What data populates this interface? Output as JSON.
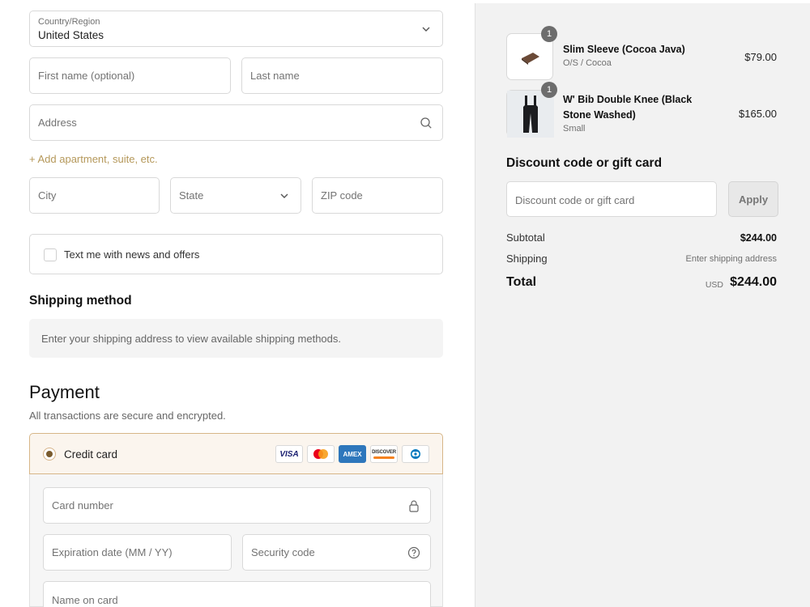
{
  "form": {
    "country": {
      "label": "Country/Region",
      "value": "United States"
    },
    "first_name": {
      "placeholder": "First name (optional)"
    },
    "last_name": {
      "placeholder": "Last name"
    },
    "address": {
      "placeholder": "Address"
    },
    "add_apartment": "+ Add apartment, suite, etc.",
    "city": {
      "placeholder": "City"
    },
    "state": {
      "placeholder": "State"
    },
    "zip": {
      "placeholder": "ZIP code"
    },
    "text_me": "Text me with news and offers"
  },
  "shipping": {
    "heading": "Shipping method",
    "message": "Enter your shipping address to view available shipping methods."
  },
  "payment": {
    "heading": "Payment",
    "subtitle": "All transactions are secure and encrypted.",
    "method_label": "Credit card",
    "card_brands": [
      "VISA",
      "mastercard",
      "AMEX",
      "DISCOVER",
      "diners-club"
    ],
    "card_number": {
      "placeholder": "Card number"
    },
    "expiration": {
      "placeholder": "Expiration date (MM / YY)"
    },
    "security_code": {
      "placeholder": "Security code"
    },
    "name_on_card": {
      "placeholder": "Name on card"
    }
  },
  "cart": {
    "items": [
      {
        "qty": "1",
        "name": "Slim Sleeve (Cocoa Java)",
        "variant": "O/S / Cocoa",
        "price": "$79.00"
      },
      {
        "qty": "1",
        "name_line1": "W' Bib Double Knee (Black",
        "name_line2": "Stone Washed)",
        "variant": "Small",
        "price": "$165.00"
      }
    ],
    "discount": {
      "heading": "Discount code or gift card",
      "placeholder": "Discount code or gift card",
      "apply_label": "Apply"
    },
    "summary": {
      "subtotal_label": "Subtotal",
      "subtotal_value": "$244.00",
      "shipping_label": "Shipping",
      "shipping_value": "Enter shipping address",
      "total_label": "Total",
      "currency": "USD",
      "total_value": "$244.00"
    }
  },
  "colors": {
    "accent": "#b5985a",
    "selected_bg": "#fbf5ee",
    "selected_border": "#d7b688",
    "sidebar_bg": "#f2f2f2"
  }
}
